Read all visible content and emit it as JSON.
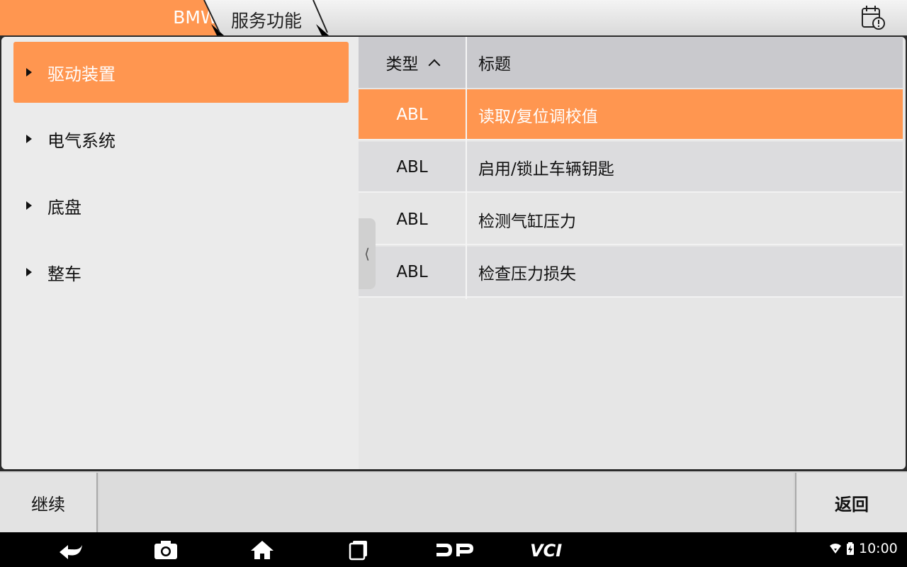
{
  "breadcrumb": {
    "make": "BMW",
    "section": "服务功能"
  },
  "sidebar": {
    "items": [
      {
        "label": "驱动装置",
        "active": true
      },
      {
        "label": "电气系统",
        "active": false
      },
      {
        "label": "底盘",
        "active": false
      },
      {
        "label": "整车",
        "active": false
      }
    ]
  },
  "table": {
    "headers": {
      "type": "类型",
      "title": "标题"
    },
    "rows": [
      {
        "type": "ABL",
        "title": "读取/复位调校值"
      },
      {
        "type": "ABL",
        "title": "启用/锁止车辆钥匙"
      },
      {
        "type": "ABL",
        "title": "检测气缸压力"
      },
      {
        "type": "ABL",
        "title": "检查压力损失"
      }
    ]
  },
  "buttons": {
    "continue": "继续",
    "back": "返回"
  },
  "navbar": {
    "dp_label": "DP",
    "vci_label": "VCI",
    "time": "10:00"
  },
  "colors": {
    "accent": "#ff9650"
  }
}
